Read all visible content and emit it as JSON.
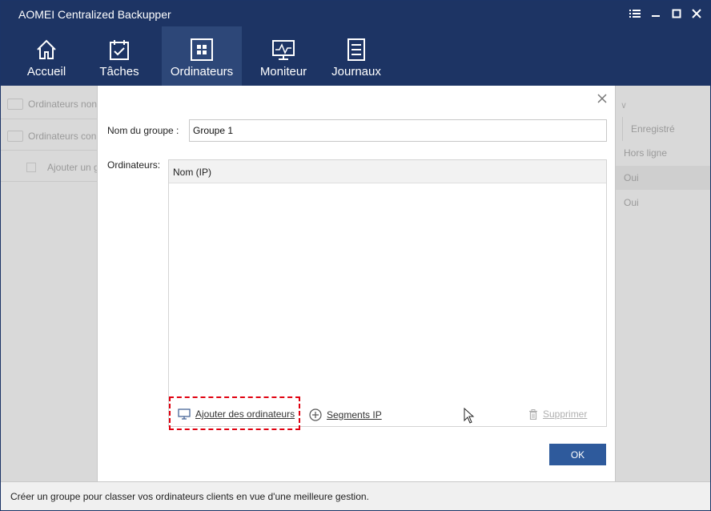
{
  "app": {
    "title": "AOMEI Centralized Backupper"
  },
  "nav": {
    "items": [
      {
        "label": "Accueil",
        "icon": "home-icon"
      },
      {
        "label": "Tâches",
        "icon": "calendar-check-icon"
      },
      {
        "label": "Ordinateurs",
        "icon": "windows-icon",
        "active": true
      },
      {
        "label": "Moniteur",
        "icon": "monitor-chart-icon"
      },
      {
        "label": "Journaux",
        "icon": "log-list-icon"
      }
    ]
  },
  "background": {
    "left_rows": [
      "Ordinateurs non",
      "Ordinateurs con",
      "Ajouter un g"
    ],
    "right_header": "Enregistré",
    "right_cells": [
      "Hors ligne",
      "Oui",
      "Oui"
    ]
  },
  "dialog": {
    "group_name_label": "Nom du groupe :",
    "group_name_value": "Groupe 1",
    "computers_label": "Ordinateurs:",
    "column_header": "Nom (IP)",
    "add_computers": "Ajouter des ordinateurs",
    "ip_segments": "Segments IP",
    "delete": "Supprimer",
    "ok": "OK"
  },
  "statusbar": {
    "text": "Créer un groupe pour classer vos ordinateurs clients en vue d'une meilleure gestion."
  },
  "colors": {
    "header": "#1d3464",
    "nav_active": "#2d4778",
    "ok_button": "#2e5a9c",
    "highlight": "#e0000f"
  }
}
